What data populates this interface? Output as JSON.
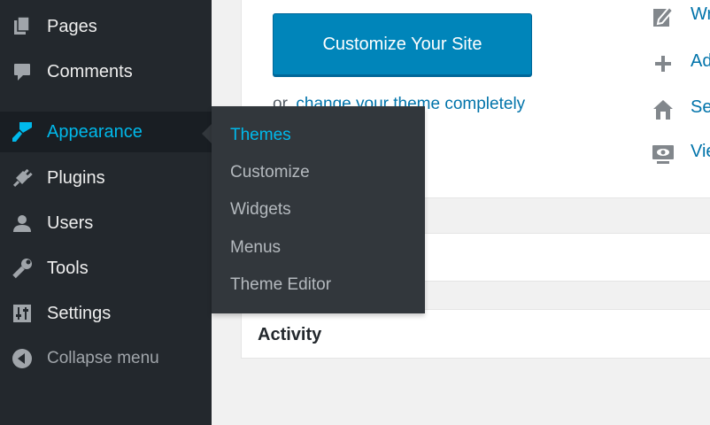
{
  "sidebar": {
    "items": [
      {
        "label": "Pages",
        "icon": "pages-icon"
      },
      {
        "label": "Comments",
        "icon": "comments-icon"
      },
      {
        "label": "Appearance",
        "icon": "appearance-brush-icon",
        "active": true
      },
      {
        "label": "Plugins",
        "icon": "plugins-icon"
      },
      {
        "label": "Users",
        "icon": "users-icon"
      },
      {
        "label": "Tools",
        "icon": "tools-wrench-icon"
      },
      {
        "label": "Settings",
        "icon": "settings-sliders-icon"
      },
      {
        "label": "Collapse menu",
        "icon": "collapse-arrow-icon"
      }
    ]
  },
  "flyout": {
    "items": [
      {
        "label": "Themes",
        "current": true
      },
      {
        "label": "Customize"
      },
      {
        "label": "Widgets"
      },
      {
        "label": "Menus"
      },
      {
        "label": "Theme Editor"
      }
    ]
  },
  "welcome": {
    "customize_button": "Customize Your Site",
    "change_theme_prefix": "or,",
    "change_theme_link": "change your theme completely"
  },
  "next_steps": [
    {
      "label": "Wr",
      "icon": "write-edit-icon"
    },
    {
      "label": "Ad",
      "icon": "plus-icon"
    },
    {
      "label": "Se",
      "icon": "home-icon"
    },
    {
      "label": "Vie",
      "icon": "view-screen-icon"
    }
  ],
  "activity": {
    "title": "Activity"
  },
  "colors": {
    "sidebar_bg": "#23282d",
    "flyout_bg": "#32373c",
    "accent": "#00b9eb",
    "primary_button": "#0085ba",
    "link": "#0073aa"
  }
}
